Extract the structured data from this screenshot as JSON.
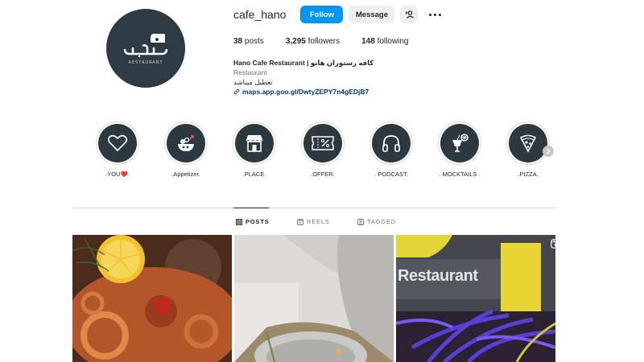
{
  "profile": {
    "username": "cafe_hano",
    "follow_label": "Follow",
    "message_label": "Message",
    "avatar_caption": "RESTAURANT",
    "stats": [
      {
        "count": "38",
        "label": "posts"
      },
      {
        "count": "3,295",
        "label": "followers"
      },
      {
        "count": "148",
        "label": "following"
      }
    ],
    "bio": {
      "name": "Hano Cafe Restaurant | کافه رستوران هانو",
      "category": "Restaurant",
      "text": "تعطیل میباشد",
      "link": "maps.app.goo.gl/DwtyZEPY7n4gEDjB7"
    }
  },
  "highlights": [
    {
      "label": ".YOU❤️.",
      "icon": "heart-icon"
    },
    {
      "label": ".Appetizer.",
      "icon": "salad-bowl-icon"
    },
    {
      "label": ".PLACE.",
      "icon": "store-icon"
    },
    {
      "label": ".OFFER.",
      "icon": "discount-ticket-icon"
    },
    {
      "label": ". PODCAST.",
      "icon": "headphones-icon"
    },
    {
      "label": ". MOCKTAILS .",
      "icon": "cocktail-icon"
    },
    {
      "label": ".PIZZA.",
      "icon": "pizza-icon"
    }
  ],
  "tabs": [
    {
      "label": "POSTS",
      "icon": "grid-icon",
      "active": true
    },
    {
      "label": "REELS",
      "icon": "reels-icon",
      "active": false
    },
    {
      "label": "TAGGED",
      "icon": "tagged-icon",
      "active": false
    }
  ],
  "posts": [
    {
      "description_icon": "pasta-dish-photo"
    },
    {
      "description_icon": "plate-photo"
    },
    {
      "description_icon": "restaurant-sign-photo",
      "overlay_text": "Restaurant",
      "reel": true
    }
  ],
  "colors": {
    "accent": "#0095f6",
    "highlight_bg": "#2d3940",
    "link": "#00376b",
    "muted": "#737373"
  }
}
